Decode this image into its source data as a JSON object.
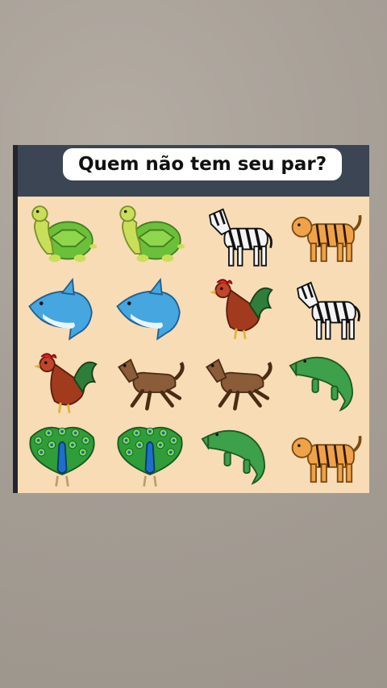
{
  "title": "Quem não tem seu par?",
  "grid": [
    [
      "turtle-icon",
      "turtle-icon",
      "zebra-icon",
      "tiger-icon"
    ],
    [
      "dolphin-icon",
      "dolphin-icon",
      "rooster-icon",
      "zebra-icon"
    ],
    [
      "rooster-icon",
      "horse-icon",
      "horse-icon",
      "crocodile-icon"
    ],
    [
      "peacock-icon",
      "peacock-icon",
      "crocodile-icon",
      "tiger-icon"
    ]
  ],
  "colors": {
    "panel": "#f7dcb5",
    "header": "#3b4553",
    "background": "#a69f96"
  }
}
